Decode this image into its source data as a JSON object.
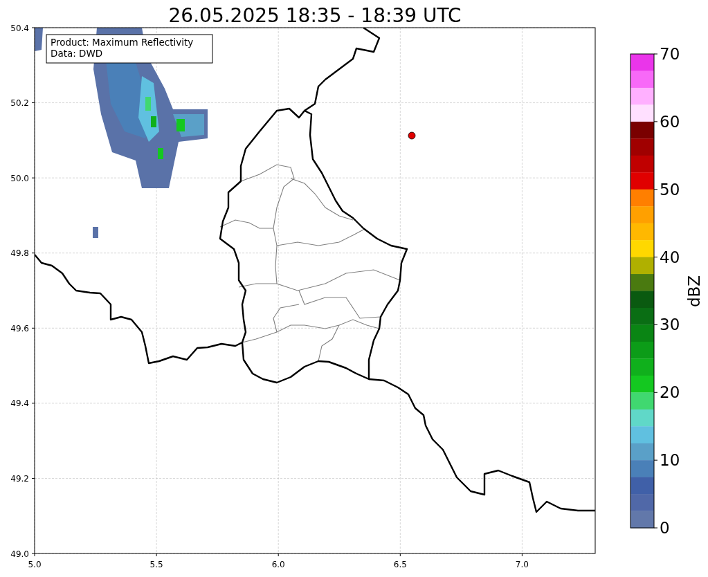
{
  "title": "26.05.2025 18:35 - 18:39 UTC",
  "info_box": {
    "lines": [
      "Product: Maximum Reflectivity",
      "Data: DWD"
    ]
  },
  "map": {
    "xticks": [
      "5.0",
      "5.5",
      "6.0",
      "6.5",
      "7.0"
    ],
    "yticks": [
      "50.4",
      "50.2",
      "50.0",
      "49.8",
      "49.6",
      "49.4",
      "49.2",
      "49.0"
    ]
  },
  "colorbar": {
    "label": "dBZ",
    "ticks": [
      "70",
      "60",
      "50",
      "40",
      "30",
      "20",
      "10",
      "0"
    ],
    "segments": [
      {
        "color": "#ea35ea"
      },
      {
        "color": "#f869f8"
      },
      {
        "color": "#ffb0ff"
      },
      {
        "color": "#ffe0ff"
      },
      {
        "color": "#7a0000"
      },
      {
        "color": "#a00000"
      },
      {
        "color": "#c00000"
      },
      {
        "color": "#e00000"
      },
      {
        "color": "#ff7f00"
      },
      {
        "color": "#ffa000"
      },
      {
        "color": "#ffb800"
      },
      {
        "color": "#ffd800"
      },
      {
        "color": "#b0b000"
      },
      {
        "color": "#4a7a10"
      },
      {
        "color": "#0a5a10"
      },
      {
        "color": "#0a6e14"
      },
      {
        "color": "#0a8514"
      },
      {
        "color": "#0c9c18"
      },
      {
        "color": "#10b01c"
      },
      {
        "color": "#14c820"
      },
      {
        "color": "#40d870"
      },
      {
        "color": "#60d8c8"
      },
      {
        "color": "#60c0e0"
      },
      {
        "color": "#5aa0c8"
      },
      {
        "color": "#4a80b8"
      },
      {
        "color": "#4060a8"
      },
      {
        "color": "#5068a8"
      },
      {
        "color": "#6278aa"
      }
    ]
  }
}
